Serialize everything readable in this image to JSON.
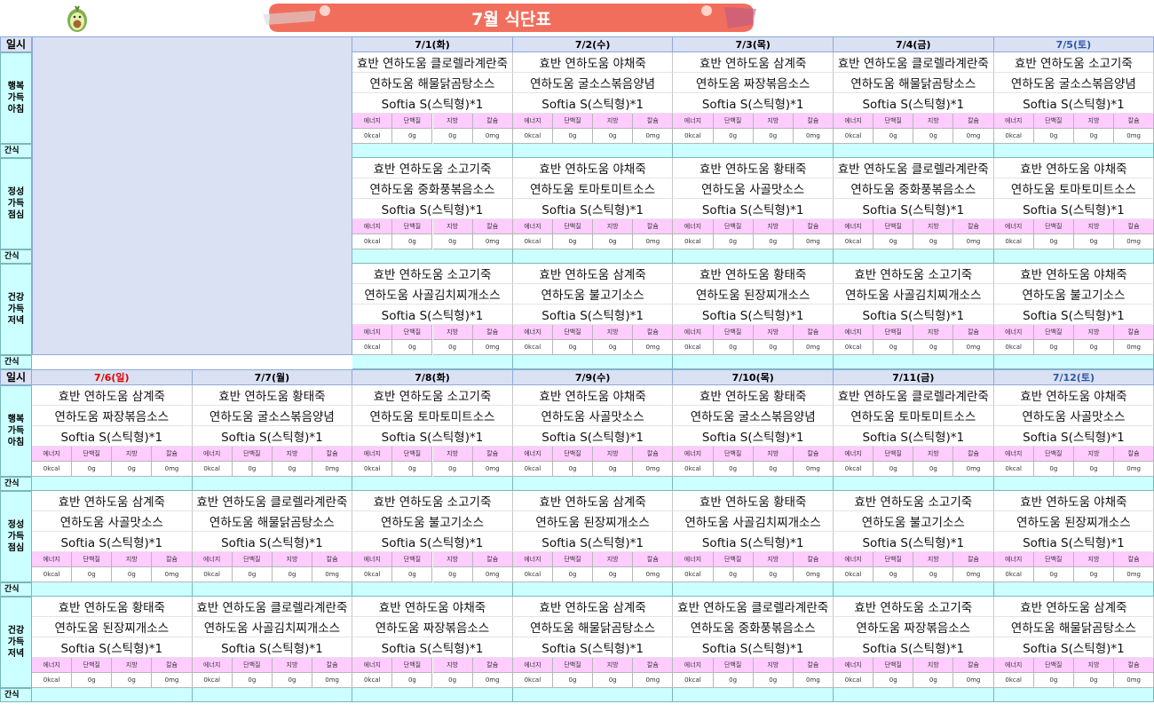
{
  "title": "7월 식단표",
  "colors": {
    "header_bg": "#d9e1f2",
    "snack_bg": "#ccffff",
    "nutrition_bg": "#ffccff",
    "sun": "#e00000",
    "sat": "#2f55a8"
  },
  "labels": {
    "date": "일시",
    "snack": "간식",
    "meals": [
      "행복\n가득\n아침",
      "정성\n가득\n점심",
      "건강\n가득\n저녁"
    ]
  },
  "nutrition_headers": [
    "에너지",
    "단백질",
    "지방",
    "칼슘"
  ],
  "nutrition_values": [
    "0kcal",
    "0g",
    "0g",
    "0mg"
  ],
  "week1": {
    "days": [
      {
        "date": "7/1(화)",
        "type": "wk",
        "meals": [
          [
            "효반 연하도움 클로렐라계란죽",
            "연하도움 해물닭곰탕소스",
            "Softia S(스틱형)*1"
          ],
          [
            "효반 연하도움 소고기죽",
            "연하도움 중화풍볶음소스",
            "Softia S(스틱형)*1"
          ],
          [
            "효반 연하도움 소고기죽",
            "연하도움 사골김치찌개소스",
            "Softia S(스틱형)*1"
          ]
        ]
      },
      {
        "date": "7/2(수)",
        "type": "wk",
        "meals": [
          [
            "효반 연하도움 야채죽",
            "연하도움 굴소스볶음양념",
            "Softia S(스틱형)*1"
          ],
          [
            "효반 연하도움 야채죽",
            "연하도움 토마토미트소스",
            "Softia S(스틱형)*1"
          ],
          [
            "효반 연하도움 삼계죽",
            "연하도움 불고기소스",
            "Softia S(스틱형)*1"
          ]
        ]
      },
      {
        "date": "7/3(목)",
        "type": "wk",
        "meals": [
          [
            "효반 연하도움 삼계죽",
            "연하도움 짜장볶음소스",
            "Softia S(스틱형)*1"
          ],
          [
            "효반 연하도움 황태죽",
            "연하도움 사골맛소스",
            "Softia S(스틱형)*1"
          ],
          [
            "효반 연하도움 황태죽",
            "연하도움 된장찌개소스",
            "Softia S(스틱형)*1"
          ]
        ]
      },
      {
        "date": "7/4(금)",
        "type": "wk",
        "meals": [
          [
            "효반 연하도움 클로렐라계란죽",
            "연하도움 해물닭곰탕소스",
            "Softia S(스틱형)*1"
          ],
          [
            "효반 연하도움 클로렐라계란죽",
            "연하도움 중화풍볶음소스",
            "Softia S(스틱형)*1"
          ],
          [
            "효반 연하도움 소고기죽",
            "연하도움 사골김치찌개소스",
            "Softia S(스틱형)*1"
          ]
        ]
      },
      {
        "date": "7/5(토)",
        "type": "sat",
        "meals": [
          [
            "효반 연하도움 소고기죽",
            "연하도움 굴소스볶음양념",
            "Softia S(스틱형)*1"
          ],
          [
            "효반 연하도움 야채죽",
            "연하도움 토마토미트소스",
            "Softia S(스틱형)*1"
          ],
          [
            "효반 연하도움 야채죽",
            "연하도움 불고기소스",
            "Softia S(스틱형)*1"
          ]
        ]
      }
    ]
  },
  "week2": {
    "days": [
      {
        "date": "7/6(일)",
        "type": "sun",
        "meals": [
          [
            "효반 연하도움 삼계죽",
            "연하도움 짜장볶음소스",
            "Softia S(스틱형)*1"
          ],
          [
            "효반 연하도움 삼계죽",
            "연하도움 사골맛소스",
            "Softia S(스틱형)*1"
          ],
          [
            "효반 연하도움 황태죽",
            "연하도움 된장찌개소스",
            "Softia S(스틱형)*1"
          ]
        ]
      },
      {
        "date": "7/7(월)",
        "type": "wk",
        "meals": [
          [
            "효반 연하도움 황태죽",
            "연하도움 굴소스볶음양념",
            "Softia S(스틱형)*1"
          ],
          [
            "효반 연하도움 클로렐라계란죽",
            "연하도움 해물닭곰탕소스",
            "Softia S(스틱형)*1"
          ],
          [
            "효반 연하도움 클로렐라계란죽",
            "연하도움 사골김치찌개소스",
            "Softia S(스틱형)*1"
          ]
        ]
      },
      {
        "date": "7/8(화)",
        "type": "wk",
        "meals": [
          [
            "효반 연하도움 소고기죽",
            "연하도움 토마토미트소스",
            "Softia S(스틱형)*1"
          ],
          [
            "효반 연하도움 소고기죽",
            "연하도움 불고기소스",
            "Softia S(스틱형)*1"
          ],
          [
            "효반 연하도움 야채죽",
            "연하도움 짜장볶음소스",
            "Softia S(스틱형)*1"
          ]
        ]
      },
      {
        "date": "7/9(수)",
        "type": "wk",
        "meals": [
          [
            "효반 연하도움 야채죽",
            "연하도움 사골맛소스",
            "Softia S(스틱형)*1"
          ],
          [
            "효반 연하도움 삼계죽",
            "연하도움 된장찌개소스",
            "Softia S(스틱형)*1"
          ],
          [
            "효반 연하도움 삼계죽",
            "연하도움 해물닭곰탕소스",
            "Softia S(스틱형)*1"
          ]
        ]
      },
      {
        "date": "7/10(목)",
        "type": "wk",
        "meals": [
          [
            "효반 연하도움 황태죽",
            "연하도움 굴소스볶음양념",
            "Softia S(스틱형)*1"
          ],
          [
            "효반 연하도움 황태죽",
            "연하도움 사골김치찌개소스",
            "Softia S(스틱형)*1"
          ],
          [
            "효반 연하도움 클로렐라계란죽",
            "연하도움 중화풍볶음소스",
            "Softia S(스틱형)*1"
          ]
        ]
      },
      {
        "date": "7/11(금)",
        "type": "wk",
        "meals": [
          [
            "효반 연하도움 클로렐라계란죽",
            "연하도움 토마토미트소스",
            "Softia S(스틱형)*1"
          ],
          [
            "효반 연하도움 소고기죽",
            "연하도움 불고기소스",
            "Softia S(스틱형)*1"
          ],
          [
            "효반 연하도움 소고기죽",
            "연하도움 짜장볶음소스",
            "Softia S(스틱형)*1"
          ]
        ]
      },
      {
        "date": "7/12(토)",
        "type": "sat",
        "meals": [
          [
            "효반 연하도움 야채죽",
            "연하도움 사골맛소스",
            "Softia S(스틱형)*1"
          ],
          [
            "효반 연하도움 야채죽",
            "연하도움 된장찌개소스",
            "Softia S(스틱형)*1"
          ],
          [
            "효반 연하도움 삼계죽",
            "연하도움 해물닭곰탕소스",
            "Softia S(스틱형)*1"
          ]
        ]
      }
    ]
  }
}
